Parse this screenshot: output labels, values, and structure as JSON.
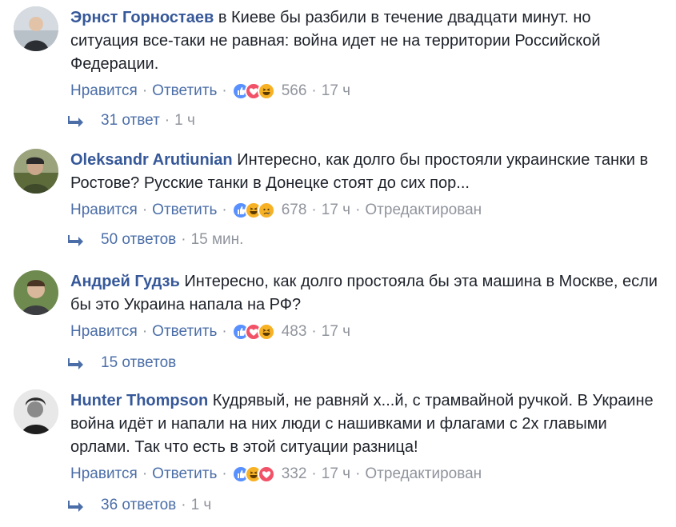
{
  "comments": [
    {
      "author": "Эрнст Горностаев",
      "text": "в Киеве бы разбили в течение двадцати минут. но ситуация все-таки не равная: война идет не на территории Российской Федерации.",
      "like_label": "Нравится",
      "reply_label": "Ответить",
      "reactions": [
        "like-icon",
        "love-icon",
        "haha-icon"
      ],
      "reaction_count": "566",
      "time": "17 ч",
      "edited": "",
      "replies_label": "31 ответ",
      "replies_time": "1 ч"
    },
    {
      "author": "Oleksandr Arutiunian",
      "text": "Интересно, как долго бы простояли украинские танки в Ростове? Русские танки в Донецке стоят до сих пор...",
      "like_label": "Нравится",
      "reply_label": "Ответить",
      "reactions": [
        "like-icon",
        "haha-icon",
        "sad-icon"
      ],
      "reaction_count": "678",
      "time": "17 ч",
      "edited": "Отредактирован",
      "replies_label": "50 ответов",
      "replies_time": "15 мин."
    },
    {
      "author": "Андрей Гудзь",
      "text": "Интересно, как долго простояла бы эта машина в Москве, если бы это Украина напала на РФ?",
      "like_label": "Нравится",
      "reply_label": "Ответить",
      "reactions": [
        "like-icon",
        "love-icon",
        "haha-icon"
      ],
      "reaction_count": "483",
      "time": "17 ч",
      "edited": "",
      "replies_label": "15 ответов",
      "replies_time": ""
    },
    {
      "author": "Hunter Thompson",
      "text": "Кудрявый, не равняй х...й, с трамвайной ручкой. В Украине война идёт и напали на них люди с нашивками и флагами с 2х главыми орлами. Так что есть в этой ситуации разница!",
      "like_label": "Нравится",
      "reply_label": "Ответить",
      "reactions": [
        "like-icon",
        "haha-icon",
        "love-icon"
      ],
      "reaction_count": "332",
      "time": "17 ч",
      "edited": "Отредактирован",
      "replies_label": "36 ответов",
      "replies_time": "1 ч"
    }
  ],
  "separator": "·",
  "colors": {
    "author": "#365899",
    "link": "#4b6ea8",
    "meta": "#90949c",
    "text": "#1d2129",
    "like": "#5890ff",
    "love": "#f25268",
    "haha": "#f7b125"
  }
}
